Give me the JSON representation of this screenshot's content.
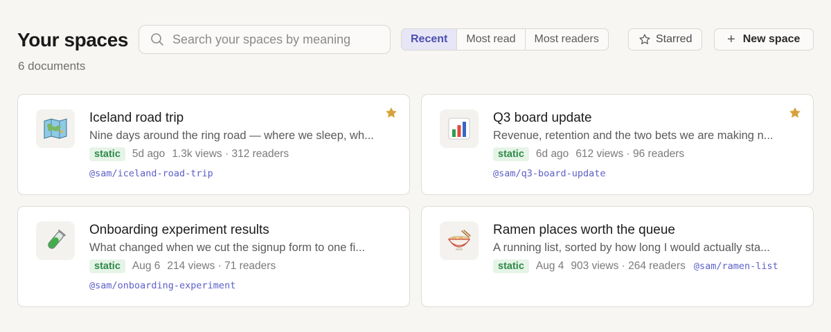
{
  "header": {
    "title": "Your spaces",
    "count": "6 documents",
    "search_placeholder": "Search your spaces by meaning",
    "sort_tabs": [
      {
        "label": "Recent",
        "active": true
      },
      {
        "label": "Most read",
        "active": false
      },
      {
        "label": "Most readers",
        "active": false
      }
    ],
    "starred_label": "Starred",
    "new_space_label": "New space"
  },
  "colors": {
    "accent": "#4d4fb0",
    "badge_text": "#2f8a4a",
    "star": "#d6a23a",
    "slug": "#5b5fc7"
  },
  "cards": [
    {
      "icon": "map-icon",
      "title": "Iceland road trip",
      "description": "Nine days around the ring road — where we sleep, wh...",
      "badge": "static",
      "age": "5d ago",
      "stats": "1.3k views · 312 readers",
      "slug": "@sam/iceland-road-trip",
      "starred": true
    },
    {
      "icon": "bar-chart-icon",
      "title": "Q3 board update",
      "description": "Revenue, retention and the two bets we are making n...",
      "badge": "static",
      "age": "6d ago",
      "stats": "612 views · 96 readers",
      "slug": "@sam/q3-board-update",
      "starred": true
    },
    {
      "icon": "test-tube-icon",
      "title": "Onboarding experiment results",
      "description": "What changed when we cut the signup form to one fi...",
      "badge": "static",
      "age": "Aug 6",
      "stats": "214 views · 71 readers",
      "slug": "@sam/onboarding-experiment",
      "starred": false
    },
    {
      "icon": "ramen-bowl-icon",
      "title": "Ramen places worth the queue",
      "description": "A running list, sorted by how long I would actually sta...",
      "badge": "static",
      "age": "Aug 4",
      "stats": "903 views · 264 readers",
      "slug": "@sam/ramen-list",
      "starred": false
    }
  ]
}
